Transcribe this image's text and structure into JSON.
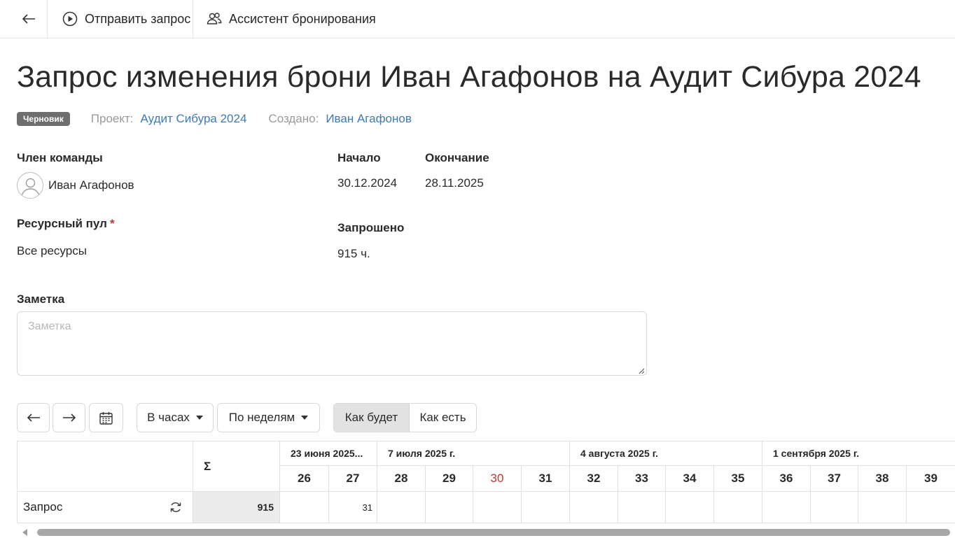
{
  "toolbar": {
    "back_icon": "arrow-left-icon",
    "send_label": "Отправить запрос",
    "send_icon": "play-circle-icon",
    "assistant_label": "Ассистент бронирования",
    "assistant_icon": "users-icon"
  },
  "page_title": "Запрос изменения брони Иван Агафонов на Аудит Сибура 2024",
  "meta": {
    "status_badge": "Черновик",
    "status_color": "#6e6e6e",
    "project_label": "Проект:",
    "project_value": "Аудит Сибура 2024",
    "created_label": "Создано:",
    "created_value": "Иван Агафонов",
    "link_color": "#3d7bb5"
  },
  "fields": {
    "member_label": "Член команды",
    "member_value": "Иван Агафонов",
    "start_label": "Начало",
    "start_value": "30.12.2024",
    "end_label": "Окончание",
    "end_value": "28.11.2025",
    "pool_label": "Ресурсный пул",
    "pool_required": "*",
    "pool_value": "Все ресурсы",
    "requested_label": "Запрошено",
    "requested_value": "915 ч.",
    "note_label": "Заметка",
    "note_placeholder": "Заметка",
    "note_value": ""
  },
  "controls": {
    "prev_icon": "arrow-left-icon",
    "next_icon": "arrow-right-icon",
    "calendar_icon": "calendar-icon",
    "units_select": "В часах",
    "period_select": "По неделям",
    "view_toggle": [
      "Как будет",
      "Как есть"
    ],
    "view_active": "Как будет"
  },
  "grid": {
    "sum_header": "Σ",
    "months": [
      {
        "label": "23 июня 2025..."
      },
      {
        "label": "7 июля 2025 г."
      },
      {
        "label": "4 августа 2025 г."
      },
      {
        "label": "1 сентября 2025 г."
      }
    ],
    "weeks": [
      "26",
      "27",
      "28",
      "29",
      "30",
      "31",
      "32",
      "33",
      "34",
      "35",
      "36",
      "37",
      "38",
      "39"
    ],
    "highlighted_week": "30",
    "highlight_color": "#d32f2f",
    "rows": [
      {
        "label": "Запрос",
        "icon": "refresh-icon",
        "sum": "915",
        "values": [
          "",
          "31",
          "",
          "",
          "",
          "",
          "",
          "",
          "",
          "",
          "",
          "",
          "",
          ""
        ]
      }
    ]
  }
}
